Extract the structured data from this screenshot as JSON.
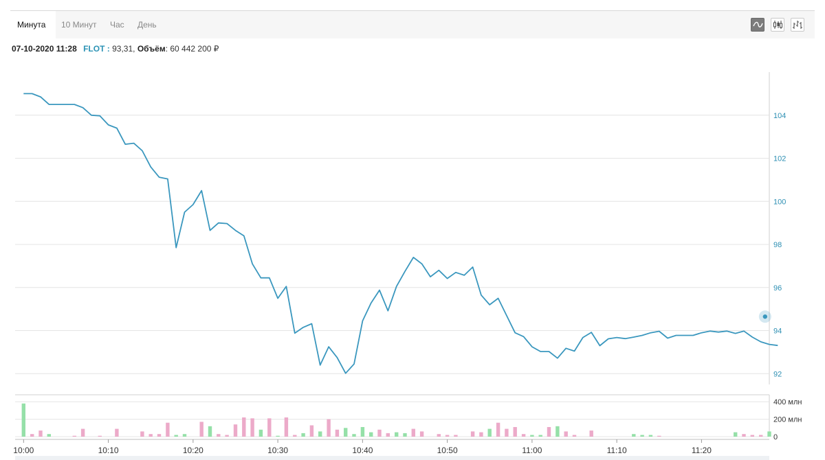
{
  "tabs": [
    {
      "label": "Минута",
      "active": true
    },
    {
      "label": "10 Минут",
      "active": false
    },
    {
      "label": "Час",
      "active": false
    },
    {
      "label": "День",
      "active": false
    }
  ],
  "view_modes": [
    {
      "icon": "line-chart-icon",
      "active": true
    },
    {
      "icon": "candlestick-icon",
      "active": false
    },
    {
      "icon": "ohlc-bars-icon",
      "active": false
    }
  ],
  "info": {
    "datetime": "07-10-2020 11:28",
    "symbol": "FLOT :",
    "price": "93,31,",
    "volume_label": "Объём",
    "volume_value": ": 60 442 200 ₽"
  },
  "colors": {
    "line": "#3a97be",
    "volume_up": "#95e0a8",
    "volume_down": "#ecaac9",
    "grid": "#e4e4e4",
    "price_axis_text": "#2d8fb3"
  },
  "chart_data": [
    {
      "type": "line",
      "series_kind": "price",
      "x_unit": "minutes since 10:00",
      "x_tick_labels": [
        "10:00",
        "10:10",
        "10:20",
        "10:30",
        "10:40",
        "10:50",
        "11:00",
        "11:10",
        "11:20"
      ],
      "xlim": [
        -1,
        88
      ],
      "ylim": [
        91.5,
        106
      ],
      "y_tick_labels": [
        "92",
        "94",
        "96",
        "98",
        "100",
        "102",
        "104"
      ],
      "grid": true,
      "last_marker": {
        "x": 87.5,
        "y": 94.65
      },
      "values": [
        105.0,
        105.0,
        104.85,
        104.5,
        104.5,
        104.5,
        104.5,
        104.35,
        104.0,
        103.97,
        103.55,
        103.4,
        102.65,
        102.7,
        102.35,
        101.6,
        101.12,
        101.04,
        97.85,
        99.5,
        99.85,
        100.5,
        98.65,
        99.0,
        98.97,
        98.65,
        98.4,
        97.1,
        96.45,
        96.45,
        95.5,
        96.05,
        93.88,
        94.15,
        94.32,
        92.4,
        93.25,
        92.75,
        92.02,
        92.45,
        94.45,
        95.28,
        95.88,
        94.92,
        96.05,
        96.75,
        97.4,
        97.1,
        96.5,
        96.8,
        96.42,
        96.7,
        96.57,
        96.95,
        95.65,
        95.2,
        95.5,
        94.7,
        93.9,
        93.72,
        93.25,
        93.03,
        93.03,
        92.72,
        93.18,
        93.05,
        93.68,
        93.92,
        93.3,
        93.62,
        93.68,
        93.63,
        93.7,
        93.78,
        93.9,
        93.97,
        93.65,
        93.78,
        93.78,
        93.78,
        93.9,
        93.98,
        93.93,
        93.98,
        93.87,
        93.98,
        93.7,
        93.48,
        93.36,
        93.31
      ]
    },
    {
      "type": "bar",
      "series_kind": "volume",
      "x_unit": "minutes since 10:00",
      "xlim": [
        -1,
        88
      ],
      "ylim": [
        0,
        480
      ],
      "y_tick_labels": [
        "0",
        "200 млн",
        "400 млн"
      ],
      "grid": true,
      "values": [
        380,
        30,
        70,
        30,
        0,
        0,
        10,
        90,
        0,
        10,
        0,
        90,
        0,
        0,
        60,
        30,
        30,
        160,
        20,
        30,
        0,
        170,
        120,
        30,
        20,
        140,
        220,
        210,
        80,
        210,
        10,
        220,
        20,
        40,
        130,
        60,
        200,
        80,
        100,
        30,
        110,
        50,
        80,
        40,
        50,
        40,
        90,
        60,
        0,
        30,
        20,
        20,
        0,
        60,
        50,
        90,
        160,
        90,
        110,
        30,
        20,
        20,
        110,
        120,
        60,
        20,
        0,
        70,
        0,
        0,
        0,
        0,
        30,
        20,
        20,
        10,
        0,
        0,
        0,
        0,
        0,
        0,
        0,
        0,
        50,
        30,
        20,
        20,
        60
      ],
      "directions": [
        "up",
        "down",
        "down",
        "up",
        "up",
        "up",
        "down",
        "down",
        "up",
        "down",
        "up",
        "down",
        "up",
        "up",
        "down",
        "down",
        "down",
        "down",
        "up",
        "up",
        "up",
        "down",
        "up",
        "down",
        "down",
        "down",
        "down",
        "down",
        "up",
        "down",
        "up",
        "down",
        "down",
        "up",
        "down",
        "up",
        "down",
        "down",
        "up",
        "up",
        "up",
        "up",
        "down",
        "down",
        "up",
        "up",
        "down",
        "down",
        "up",
        "down",
        "down",
        "down",
        "up",
        "down",
        "down",
        "up",
        "down",
        "down",
        "down",
        "down",
        "up",
        "up",
        "down",
        "up",
        "down",
        "down",
        "up",
        "down",
        "up",
        "up",
        "up",
        "up",
        "up",
        "up",
        "up",
        "down",
        "up",
        "up",
        "up",
        "up",
        "up",
        "up",
        "up",
        "up",
        "up",
        "down",
        "down",
        "down",
        "up"
      ]
    }
  ]
}
